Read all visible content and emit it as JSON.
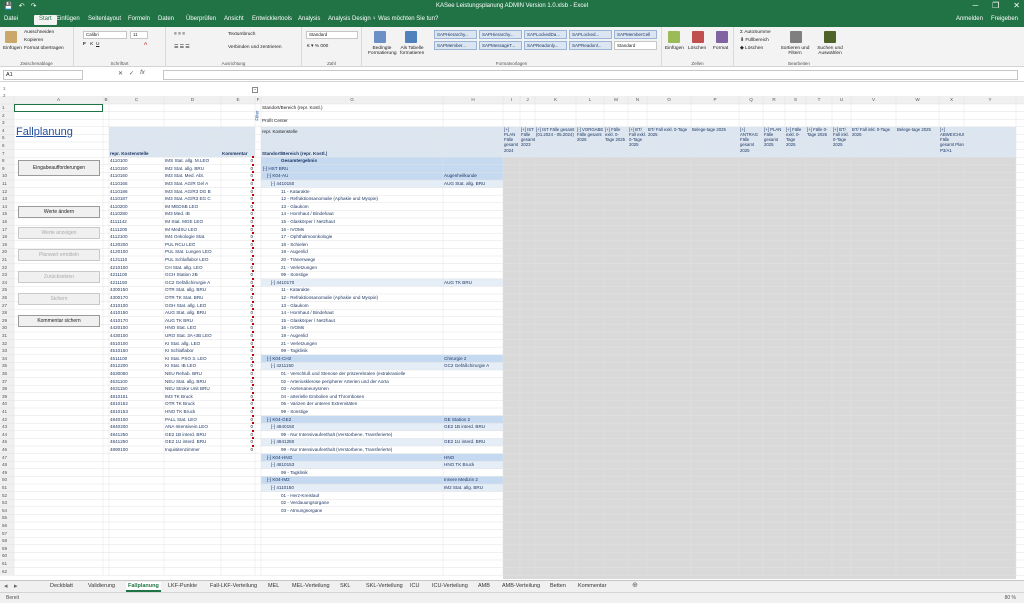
{
  "window": {
    "title": "KASee Leistungsplanung ADMIN Version 1.0.xlsb - Excel",
    "minimize": "─",
    "restore": "❐",
    "close": "✕"
  },
  "qat": {
    "save": "💾",
    "undo": "↶",
    "redo": "↷"
  },
  "tabs": [
    "Datei",
    "Start",
    "Einfügen",
    "Seitenlayout",
    "Formeln",
    "Daten",
    "Überprüfen",
    "Ansicht",
    "Entwicklertools",
    "Analysis",
    "Analysis Design",
    "♀ Was möchten Sie tun?"
  ],
  "tabs_active": 1,
  "account": {
    "signin": "Anmelden",
    "share": "Freigeben"
  },
  "ribbon": {
    "clipboard": {
      "paste": "Einfügen",
      "cut": "Ausschneiden",
      "copy": "Kopieren",
      "format_painter": "Format übertragen",
      "label": "Zwischenablage"
    },
    "font": {
      "name": "Calibri",
      "size": "11",
      "label": "Schriftart"
    },
    "alignment": {
      "wrap": "Textumbruch",
      "merge": "Verbinden und zentrieren",
      "label": "Ausrichtung"
    },
    "number": {
      "format": "Standard",
      "label": "Zahl"
    },
    "styles": {
      "conditional": "Bedingte Formatierung",
      "as_table": "Als Tabelle formatieren",
      "boxes": [
        "SAPHierarchy...",
        "SAPHierarchy...",
        "SAPLockedDa...",
        "SAPLocked...",
        "SAPMemberCell",
        "SAPMember...",
        "SAPMessageT...",
        "SAPReadonly...",
        "SAPReadonl...",
        "Standard"
      ],
      "label": "Formatvorlagen"
    },
    "cells": {
      "insert": "Einfügen",
      "delete": "Löschen",
      "format": "Format",
      "label": "Zellen"
    },
    "editing": {
      "autosum": "AutoSumme",
      "fill": "Füllbereich",
      "clear": "Löschen",
      "sort": "Sortieren und Filtern",
      "find": "Suchen und Auswählen",
      "label": "Bearbeiten"
    }
  },
  "formula": {
    "cell_ref": "A1",
    "fx": "fx",
    "cancel": "✕",
    "enter": "✓",
    "value": ""
  },
  "sheet": {
    "title": "Fallplanung",
    "buttons": {
      "input_requests": "Eingabeaufforderungen",
      "change": "Werte ändern",
      "show": "Werte anzeigen",
      "determine": "Planwert ermitteln",
      "reset": "Zurücksetzen",
      "save": "Sichern",
      "save_comment": "Kommentar sichern"
    },
    "col_headers": [
      "A",
      "B",
      "C",
      "D",
      "E",
      "F",
      "G",
      "H",
      "I",
      "J",
      "K",
      "L",
      "M",
      "N",
      "O",
      "P",
      "Q",
      "R",
      "S",
      "T",
      "U",
      "V",
      "W",
      "X",
      "Y"
    ],
    "header_labels": {
      "cost_center_col": "repr. Kostenstelle",
      "comment_col": "Kommentar",
      "area_col": "Standort/Bereich (repr. Kostl.)",
      "g1": "Standort/Bereich (repr. Kostl.)",
      "g2": "Profit Center",
      "g3": "repr. Kostenstelle",
      "vertical": "Filter"
    },
    "data_headers": [
      "[+] PLAN Fälle gesamt 2024",
      "[+] IST Fälle gesamt 2023",
      "[+] IST Fälle gesamt (01.2024 - 05.2024)",
      "[-] VORGABE Fälle gesamt 2025",
      "[+] Fälle exkl. 0-Tage 2025",
      "[+] BT/ Fall exkl. 0-Tage 2025",
      "BT/ Fall exkl. 0-Tage 2025",
      "Belege-tage 2025",
      "[+] ANTRAG Fälle gesamt 2025",
      "[+] PLAN Fälle gesamt 2025",
      "[+] Fälle exkl. 0-Tage 2025",
      "[+] Fälle 0-Tage 2025",
      "[+] BT/ Fall inkl. 0-Tage 2025",
      "BT/ Fall inkl. 0-Tage 2025",
      "Belege-tage 2025",
      "[+] ABWEICHUNG Fälle gesamt Plan P3/A1"
    ],
    "cost_centers": [
      [
        "4110100",
        "IMS Stat. allg. M.LEO"
      ],
      [
        "4110150",
        "IM2 Stat. allg.   BRU"
      ],
      [
        "4110160",
        "IM3 Stat. Med. Abt."
      ],
      [
        "4110165",
        "IM3 Stat. AG/R Gel A"
      ],
      [
        "4110186",
        "IM3 Stat. AG/R3 DG B"
      ],
      [
        "4110187",
        "IM3 Stat. AG/R3 EG C"
      ],
      [
        "4110200",
        "IM   MEDSB       LEO"
      ],
      [
        "4110280",
        "IM3 Med. IB"
      ],
      [
        "4111142",
        "IM   Stat. MGE    LEO"
      ],
      [
        "4111200",
        "IM   MedSU        LEO"
      ],
      [
        "4112100",
        "IM4 Onkologie Stat."
      ],
      [
        "4120200",
        "PUL RCU          LEO"
      ],
      [
        "4120100",
        "PUL Stat. Lungen LEO"
      ],
      [
        "4121110",
        "PUL Schlaflabor LEO"
      ],
      [
        "4210100",
        "CH  Stat. allg.   LEO"
      ],
      [
        "4211100",
        "GCH Station 2B"
      ],
      [
        "4211150",
        "GC2 Gefäßchirurgie A"
      ],
      [
        "4300150",
        "OTR Stat. allg.   BRU"
      ],
      [
        "4300170",
        "OTR TK Stat.      BRU"
      ],
      [
        "4310100",
        "GGH Stat. allg.   LEO"
      ],
      [
        "4410150",
        "AUG Stat. allg.   BRU"
      ],
      [
        "4410170",
        "AUG TK            BRU"
      ],
      [
        "4420100",
        "HNO Stat.         LEO"
      ],
      [
        "4430100",
        "URO Stat. 3A+3B  LEO"
      ],
      [
        "4510100",
        "KI  Stat. allg.   LEO"
      ],
      [
        "4510150",
        "KI  Schlaflabor"
      ],
      [
        "4511100",
        "KI  Stat. PSO 3. LEO"
      ],
      [
        "4512200",
        "KI  Stat. IB      LEO"
      ],
      [
        "4630050",
        "NEU Rehab.        BRU"
      ],
      [
        "4631100",
        "NEU Stat. allg.   BRU"
      ],
      [
        "4631150",
        "NEU Stroke Unit  BRU"
      ],
      [
        "4810151",
        "IM3 TK Bruck"
      ],
      [
        "4810152",
        "OTR TK Bruck"
      ],
      [
        "4810153",
        "HNO TK Bruck"
      ],
      [
        "4840100",
        "PALL Stat.        LEO"
      ],
      [
        "4840200",
        "ANA Intensivein.LEO"
      ],
      [
        "4841250",
        "GE2 1B interd.    BRU"
      ],
      [
        "4841250",
        "GE2 1U interd.    BRU"
      ],
      [
        "4890100",
        "Inquisitenzimmer"
      ]
    ],
    "zero": "0",
    "tree": [
      {
        "t": "Gesamtergebnis",
        "lvl": 0,
        "h": ""
      },
      {
        "t": "[-] HST BRU",
        "lvl": 0,
        "h": ""
      },
      {
        "t": "[-] K04-AU",
        "lvl": 1,
        "h": "Augenheilkunde"
      },
      {
        "t": "[-] 4410150",
        "lvl": 2,
        "h": "AUG Stat. allg.   BRU"
      },
      {
        "t": "11 - Katarakte",
        "lvl": 3,
        "h": ""
      },
      {
        "t": "12 - Refraktionsanomalie (Aphakie und Myopie)",
        "lvl": 3,
        "h": ""
      },
      {
        "t": "13 - Glaukom",
        "lvl": 3,
        "h": ""
      },
      {
        "t": "14 - Hornhaut / Bindehaut",
        "lvl": 3,
        "h": ""
      },
      {
        "t": "15 - Glaskörper / Netzhaut",
        "lvl": 3,
        "h": ""
      },
      {
        "t": "16 - IVOMs",
        "lvl": 3,
        "h": ""
      },
      {
        "t": "17 - Ophthalmoonkologie",
        "lvl": 3,
        "h": ""
      },
      {
        "t": "18 - Schielen",
        "lvl": 3,
        "h": ""
      },
      {
        "t": "19 - Augenlid",
        "lvl": 3,
        "h": ""
      },
      {
        "t": "20 - Tränenwege",
        "lvl": 3,
        "h": ""
      },
      {
        "t": "21 - Verletzungen",
        "lvl": 3,
        "h": ""
      },
      {
        "t": "99 - Sonstige",
        "lvl": 3,
        "h": ""
      },
      {
        "t": "[-] 4410170",
        "lvl": 2,
        "h": "AUG TK            BRU"
      },
      {
        "t": "11 - Katarakte",
        "lvl": 3,
        "h": ""
      },
      {
        "t": "12 - Refraktionsanomalie (Aphakie und Myopie)",
        "lvl": 3,
        "h": ""
      },
      {
        "t": "13 - Glaukom",
        "lvl": 3,
        "h": ""
      },
      {
        "t": "14 - Hornhaut / Bindehaut",
        "lvl": 3,
        "h": ""
      },
      {
        "t": "15 - Glaskörper / Netzhaut",
        "lvl": 3,
        "h": ""
      },
      {
        "t": "16 - IVOMs",
        "lvl": 3,
        "h": ""
      },
      {
        "t": "19 - Augenlid",
        "lvl": 3,
        "h": ""
      },
      {
        "t": "21 - Verletzungen",
        "lvl": 3,
        "h": ""
      },
      {
        "t": "99 - Tagklinik",
        "lvl": 3,
        "h": ""
      },
      {
        "t": "[-] K04-CH2",
        "lvl": 1,
        "h": "Chirurgie 2"
      },
      {
        "t": "[-] 4211150",
        "lvl": 2,
        "h": "GC2 Gefäßchirurgie A"
      },
      {
        "t": "01 - Verschluß und Stenose der präzerebralen (extrakranielle",
        "lvl": 3,
        "h": ""
      },
      {
        "t": "02 - Arteriosklerose peripherer Arterien und der Aorta",
        "lvl": 3,
        "h": ""
      },
      {
        "t": "03 - Aortenaneurysmen",
        "lvl": 3,
        "h": ""
      },
      {
        "t": "04 - arterielle Embolien und Thrombosen",
        "lvl": 3,
        "h": ""
      },
      {
        "t": "05 - Varizen der unteren Extremitäten",
        "lvl": 3,
        "h": ""
      },
      {
        "t": "99 - Sonstige",
        "lvl": 3,
        "h": ""
      },
      {
        "t": "[-] K04-GE2",
        "lvl": 1,
        "h": "GE Station 2"
      },
      {
        "t": "[-] 4840150",
        "lvl": 2,
        "h": "GE2 1B interd.    BRU"
      },
      {
        "t": "99 - Nur Intensivaufenthalt (Verstorbene, Transferierte)",
        "lvl": 3,
        "h": ""
      },
      {
        "t": "[-] 4841250",
        "lvl": 2,
        "h": "GE2 1U interd.    BRU"
      },
      {
        "t": "99 - Nur Intensivaufenthalt (Verstorbene, Transferierte)",
        "lvl": 3,
        "h": ""
      },
      {
        "t": "[-] K04-HNO",
        "lvl": 1,
        "h": "HNO"
      },
      {
        "t": "[-] 4810153",
        "lvl": 2,
        "h": "HNO TK Bruck"
      },
      {
        "t": "99 - Tagklinik",
        "lvl": 3,
        "h": ""
      },
      {
        "t": "[-] K04-IM2",
        "lvl": 1,
        "h": "Innere Medizin 2"
      },
      {
        "t": "[-] 4110150",
        "lvl": 2,
        "h": "IM2 Stat. allg.   BRU"
      },
      {
        "t": "01 - Herz-Kreislauf",
        "lvl": 3,
        "h": ""
      },
      {
        "t": "02 - Verdauungsorgane",
        "lvl": 3,
        "h": ""
      },
      {
        "t": "03 - Atmungsorgane",
        "lvl": 3,
        "h": ""
      }
    ]
  },
  "sheet_tabs": [
    "Deckblatt",
    "Validierung",
    "Fallplanung",
    "LKF-Punkte",
    "Fall-LKF-Verteilung",
    "MEL",
    "MEL-Verteilung",
    "SKL",
    "SKL-Verteilung",
    "ICU",
    "ICU-Verteilung",
    "AMB",
    "AMB-Verteilung",
    "Betten",
    "Kommentar"
  ],
  "sheet_tabs_active": 2,
  "status": {
    "ready": "Bereit",
    "zoom": "80 %"
  },
  "colors": {
    "accent": "#217346",
    "header_blue": "#dce6f1",
    "tree_blue": "#c5d9f1",
    "gray_fill": "#d9d9d9"
  }
}
